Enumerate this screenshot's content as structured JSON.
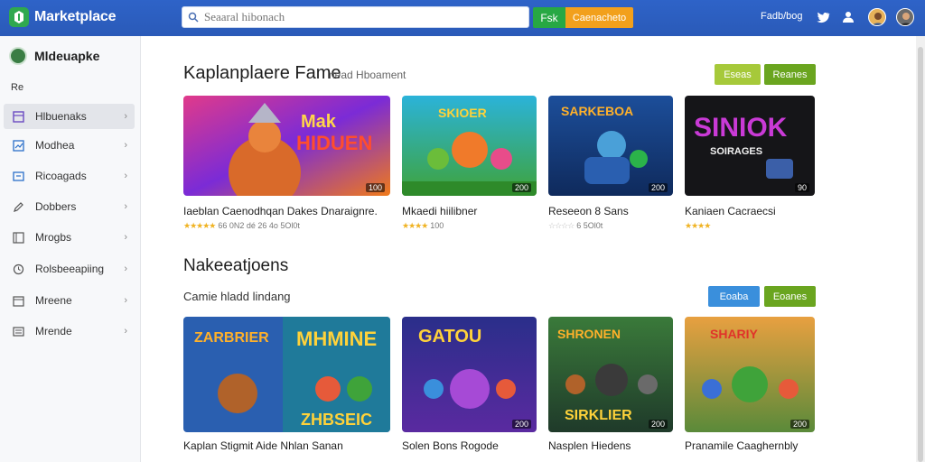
{
  "app": {
    "title": "Marketplace"
  },
  "search": {
    "placeholder": "Seaaral hibonach"
  },
  "topbar": {
    "btn_green": "Fsk",
    "btn_orange": "Caenacheto",
    "link": "Fadb/bog",
    "icons": [
      "twitter-icon",
      "user-group-icon",
      "avatar",
      "avatar"
    ]
  },
  "sidebar": {
    "user": "Mldeuapke",
    "sub": "Re",
    "items": [
      {
        "label": "Hlbuenaks",
        "icon": "grid-icon"
      },
      {
        "label": "Modhea",
        "icon": "chart-icon"
      },
      {
        "label": "Ricoagads",
        "icon": "download-icon"
      },
      {
        "label": "Dobbers",
        "icon": "edit-icon"
      },
      {
        "label": "Mrogbs",
        "icon": "image-icon"
      },
      {
        "label": "Rolsbeeapiing",
        "icon": "clock-icon"
      },
      {
        "label": "Mreene",
        "icon": "calendar-icon"
      },
      {
        "label": "Mrende",
        "icon": "list-icon"
      }
    ]
  },
  "section1": {
    "title": "Kaplanplaere Fame",
    "subtitle": "nead Hboament",
    "btn1": "Eseas",
    "btn2": "Reanes",
    "cards": [
      {
        "title": "Iaeblan Caenodhqan Dakes Dnaraignre.",
        "meta": "66 0N2 dé 26 4o 5Ol0t",
        "stars": "★★★★★",
        "badge": "100"
      },
      {
        "title": "Mkaedi hiilibner",
        "meta": "100",
        "stars": "★★★★",
        "badge": "200"
      },
      {
        "title": "Reseeon 8 Sans",
        "meta": "6 5Ol0t",
        "stars": "☆☆☆☆",
        "badge": "200"
      },
      {
        "title": "Kaniaen Cacraecsi",
        "meta": "",
        "stars": "★★★★",
        "badge": "90"
      }
    ]
  },
  "section2": {
    "title": "Nakeeatjoens",
    "subtitle": "Camie hladd lindang",
    "btn1": "Eoaba",
    "btn2": "Eoanes",
    "cards": [
      {
        "title": "Kaplan Stigmit Aide Nhlan Sanan",
        "meta": "",
        "stars": "★★★★★",
        "badge": ""
      },
      {
        "title": "Solen Bons Rogode",
        "meta": "",
        "stars": "★★★★",
        "badge": "200"
      },
      {
        "title": "Nasplen Hiedens",
        "meta": "",
        "stars": "★★★★",
        "badge": "200"
      },
      {
        "title": "Pranamile Caaghernbly",
        "meta": "",
        "stars": "★★★★",
        "badge": "200"
      }
    ]
  },
  "colors": {
    "topbar": "#2e63c8",
    "green": "#27a844",
    "orange": "#f2a01c",
    "lime": "#a6c93a",
    "dark_green": "#6aa51f",
    "blue": "#3a8fdc"
  }
}
